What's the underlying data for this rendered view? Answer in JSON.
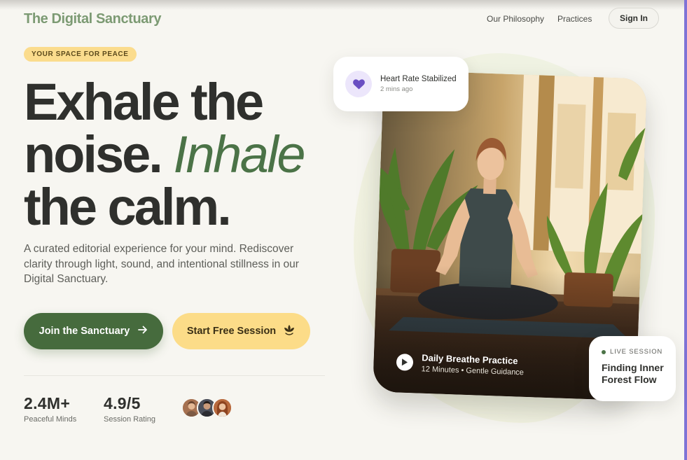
{
  "brand": {
    "name": "The Digital Sanctuary"
  },
  "nav": {
    "links": [
      "Our Philosophy",
      "Practices"
    ],
    "signin_label": "Sign In"
  },
  "hero": {
    "badge": "YOUR SPACE FOR PEACE",
    "headline_line1": "Exhale the",
    "headline_line2_a": "noise.",
    "headline_line2_b": "Inhale",
    "headline_line3": "the calm.",
    "subtext": "A curated editorial experience for your mind. Rediscover clarity through light, sound, and intentional stillness in our Digital Sanctuary.",
    "primary_button": "Join the Sanctuary",
    "secondary_button": "Start Free Session"
  },
  "stats": [
    {
      "value": "2.4M+",
      "label": "Peaceful Minds"
    },
    {
      "value": "4.9/5",
      "label": "Session Rating"
    }
  ],
  "heart_card": {
    "title": "Heart Rate Stabilized",
    "subtitle": "2 mins ago",
    "icon": "heart-icon"
  },
  "photo_caption": {
    "title": "Daily Breathe Practice",
    "subtitle": "12 Minutes • Gentle Guidance"
  },
  "live_card": {
    "label": "LIVE SESSION",
    "title": "Finding Inner Forest Flow"
  },
  "colors": {
    "brand_green": "#466b3d",
    "accent_yellow": "#fcdc88",
    "logo_green": "#7c9a73",
    "heart_purple": "#6a4fc2"
  }
}
